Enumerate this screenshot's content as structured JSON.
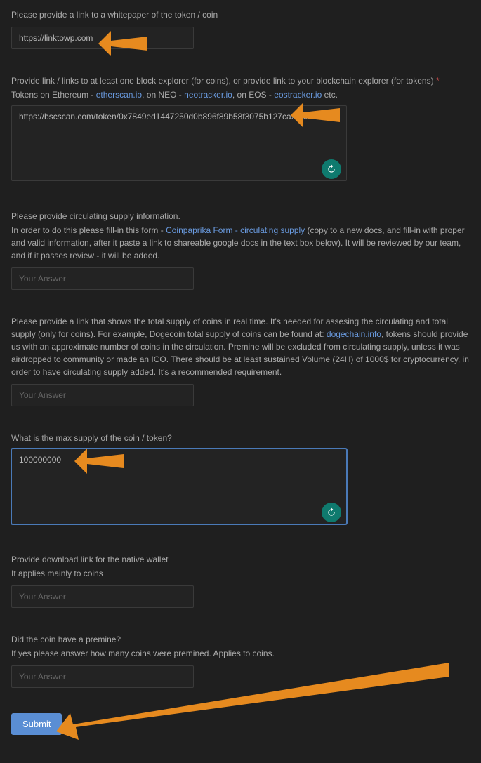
{
  "whitepaper": {
    "label": "Please provide a link to a whitepaper of the token / coin",
    "value": "https://linktowp.com"
  },
  "explorer": {
    "label_main": "Provide link / links to at least one block explorer (for coins), or provide link to your blockchain explorer (for tokens)",
    "sub_prefix": "Tokens on Ethereum - ",
    "link1": "etherscan.io",
    "mid1": ", on NEO - ",
    "link2": "neotracker.io",
    "mid2": ", on EOS - ",
    "link3": "eostracker.io",
    "suffix": " etc.",
    "value": "https://bscscan.com/token/0x7849ed1447250d0b896f89b58f3075b127ca29b3"
  },
  "circulating": {
    "label1": "Please provide circulating supply information.",
    "sub_prefix": "In order to do this please fill-in this form - ",
    "link_text": "Coinpaprika Form - circulating supply",
    "sub_suffix": " (copy to a new docs, and fill-in with proper and valid information, after it paste a link to shareable google docs in the text box below). It will be reviewed by our team, and if it passes review - it will be added.",
    "placeholder": "Your Answer"
  },
  "totalsupply": {
    "label_prefix": "Please provide a link that shows the total supply of coins in real time. It's needed for assesing the circulating and total supply (only for coins). For example, Dogecoin total supply of coins can be found at: ",
    "link_text": "dogechain.info",
    "label_suffix": ", tokens should provide us with an approximate number of coins in the circulation. Premine will be excluded from circulating supply, unless it was airdropped to community or made an ICO. There should be at least sustained Volume (24H) of 1000$ for cryptocurrency, in order to have circulating supply added. It's a recommended requirement.",
    "placeholder": "Your Answer"
  },
  "maxsupply": {
    "label": "What is the max supply of the coin / token?",
    "value": "100000000"
  },
  "wallet": {
    "label1": "Provide download link for the native wallet",
    "label2": "It applies mainly to coins",
    "placeholder": "Your Answer"
  },
  "premine": {
    "label1": "Did the coin have a premine?",
    "label2": "If yes please answer how many coins were premined. Applies to coins.",
    "placeholder": "Your Answer"
  },
  "submit_label": "Submit"
}
